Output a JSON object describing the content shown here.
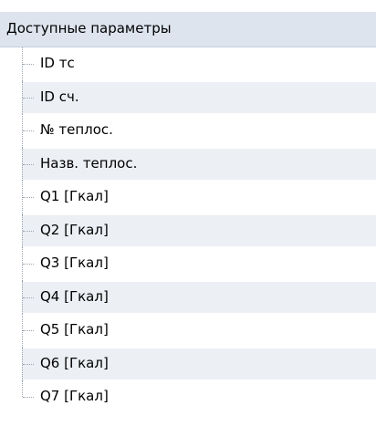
{
  "panel": {
    "header": "Доступные параметры",
    "items": [
      {
        "label": "ID тс"
      },
      {
        "label": "ID сч."
      },
      {
        "label": "№ теплос."
      },
      {
        "label": "Назв. теплос."
      },
      {
        "label": "Q1 [Гкал]"
      },
      {
        "label": "Q2 [Гкал]"
      },
      {
        "label": "Q3 [Гкал]"
      },
      {
        "label": "Q4 [Гкал]"
      },
      {
        "label": "Q5 [Гкал]"
      },
      {
        "label": "Q6 [Гкал]"
      },
      {
        "label": "Q7 [Гкал]"
      }
    ]
  }
}
